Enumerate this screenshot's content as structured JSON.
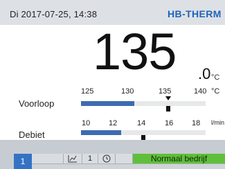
{
  "header": {
    "datetime": "Di 2017-07-25, 14:38",
    "brand": "HB-THERM"
  },
  "main_value": {
    "integer": "135",
    "decimal": ".0",
    "unit": "°C"
  },
  "voorloop": {
    "label": "Voorloop",
    "ticks": [
      "125",
      "130",
      "135",
      "140"
    ],
    "unit": "°C",
    "fill_fraction": 0.43,
    "setpoint_fraction": 0.7,
    "actual_fraction": 0.7
  },
  "debiet": {
    "label": "Debiet",
    "ticks": [
      "10",
      "12",
      "14",
      "16",
      "18"
    ],
    "unit": "l/min",
    "fill_fraction": 0.32,
    "actual_fraction": 0.5
  },
  "statusbar": {
    "tab_number": "1",
    "zone": "1",
    "mode": "Normaal bedrijf",
    "colors": {
      "mode_bg": "#5fbf3a",
      "tab_bg": "#3473c4"
    },
    "icons": [
      "chart-icon",
      "clock-icon"
    ]
  }
}
